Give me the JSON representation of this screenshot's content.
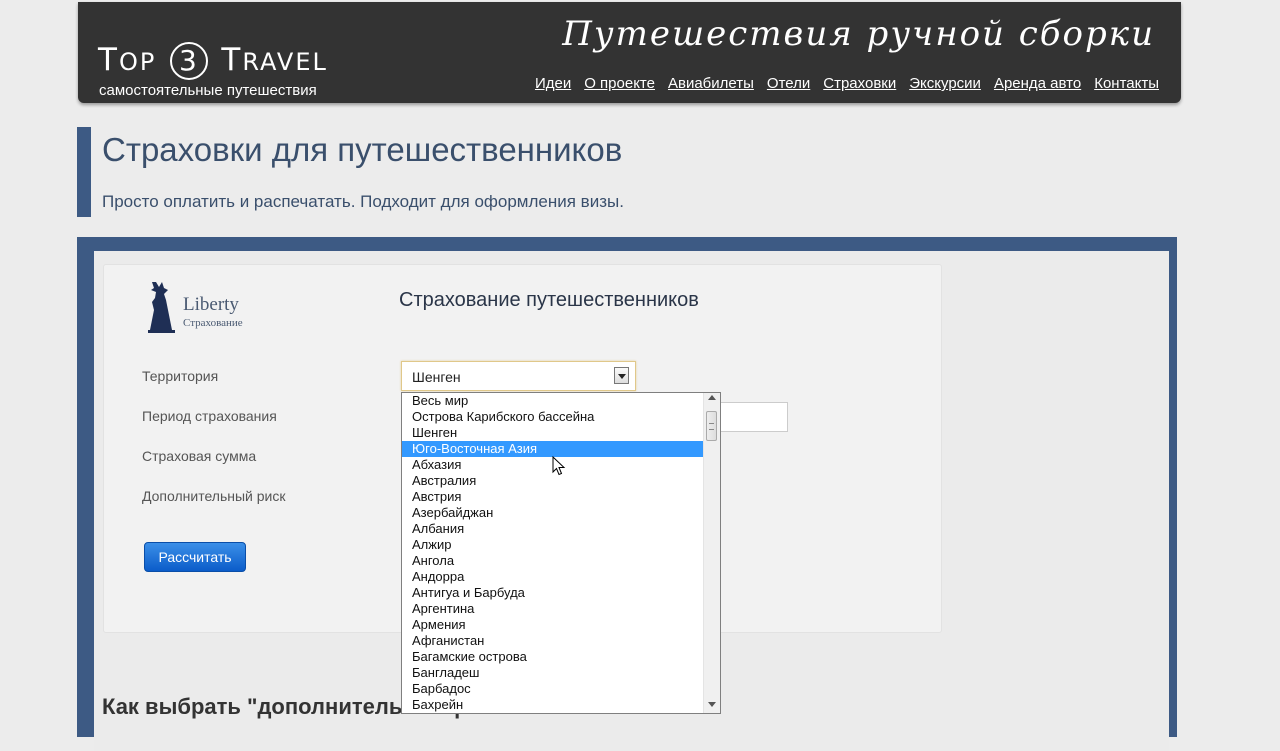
{
  "header": {
    "logo": {
      "part1_big": "T",
      "part1_small": "OP",
      "digit": "3",
      "part2_big": "T",
      "part2_small": "RAVEL"
    },
    "logo_sub": "самостоятельные путешествия",
    "slogan": "Путешествия ручной сборки",
    "nav": [
      "Идеи",
      "О проекте",
      "Авиабилеты",
      "Отели",
      "Страховки",
      "Экскурсии",
      "Аренда авто",
      "Контакты"
    ]
  },
  "page": {
    "title": "Страховки для путешественников",
    "subtitle": "Просто оплатить и распечатать. Подходит для оформления визы."
  },
  "widget": {
    "brand_name": "Liberty",
    "brand_sub": "Страхование",
    "form_title": "Страхование путешественников",
    "labels": {
      "territory": "Территория",
      "period": "Период страхования",
      "sum": "Страховая сумма",
      "extra_risk": "Дополнительный риск"
    },
    "territory_value": "Шенген",
    "calc_button": "Рассчитать"
  },
  "dropdown": {
    "options": [
      "Весь мир",
      "Острова Карибского бассейна",
      "Шенген",
      "Юго-Восточная Азия",
      "Абхазия",
      "Австралия",
      "Австрия",
      "Азербайджан",
      "Албания",
      "Алжир",
      "Ангола",
      "Андорра",
      "Антигуа и Барбуда",
      "Аргентина",
      "Армения",
      "Афганистан",
      "Багамские острова",
      "Бангладеш",
      "Барбадос",
      "Бахрейн"
    ],
    "highlighted_index": 3
  },
  "section_heading": "Как выбрать \"дополнительный риск\"",
  "colors": {
    "header_bg": "#333333",
    "accent": "#3d5a84",
    "highlight": "#3399ff",
    "button": "#1a6ad6"
  },
  "icons": [
    "liberty-statue-icon",
    "dropdown-arrow-icon",
    "scroll-up-icon",
    "scroll-down-icon",
    "mouse-cursor-icon"
  ]
}
